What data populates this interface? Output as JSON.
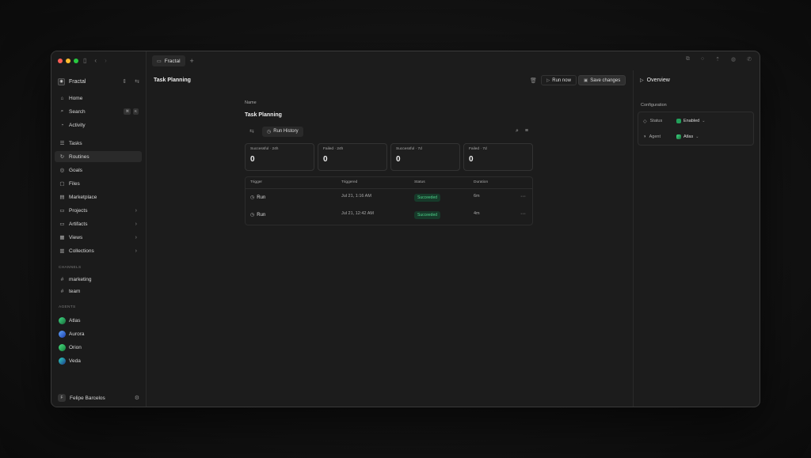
{
  "window": {
    "tab": {
      "label": "Fractal"
    },
    "tab_add": "+"
  },
  "sidebar": {
    "workspace": "Fractal",
    "nav": [
      {
        "label": "Home",
        "icon": "home-icon"
      },
      {
        "label": "Search",
        "icon": "search-icon"
      },
      {
        "label": "Activity",
        "icon": "activity-icon"
      },
      {
        "label": "Tasks",
        "icon": "tasks-icon"
      },
      {
        "label": "Routines",
        "icon": "routines-icon"
      },
      {
        "label": "Goals",
        "icon": "goals-icon"
      },
      {
        "label": "Files",
        "icon": "files-icon"
      },
      {
        "label": "Marketplace",
        "icon": "marketplace-icon"
      },
      {
        "label": "Projects",
        "icon": "folder-icon"
      },
      {
        "label": "Artifacts",
        "icon": "folder-icon"
      },
      {
        "label": "Views",
        "icon": "views-icon"
      },
      {
        "label": "Collections",
        "icon": "collections-icon"
      }
    ],
    "search_kbd": [
      "⌘",
      "K"
    ],
    "channels_label": "CHANNELS",
    "channels": [
      "marketing",
      "team"
    ],
    "agents_label": "AGENTS",
    "agents": [
      {
        "name": "Atlas",
        "color": "#2f9e44"
      },
      {
        "name": "Aurora",
        "color": "#3b82f6"
      },
      {
        "name": "Orion",
        "color": "#22a05a"
      },
      {
        "name": "Veda",
        "color": "#14b8a6"
      }
    ],
    "user": {
      "initial": "F",
      "name": "Felipe Barcelos"
    }
  },
  "main": {
    "title": "Task Planning",
    "run_now": "Run now",
    "save_changes": "Save changes",
    "name_label": "Name",
    "name_value": "Task Planning",
    "run_history": "Run History",
    "stats": [
      {
        "label": "Successful · 24h",
        "value": "0"
      },
      {
        "label": "Failed · 24h",
        "value": "0"
      },
      {
        "label": "Successful · 7d",
        "value": "0"
      },
      {
        "label": "Failed · 7d",
        "value": "0"
      }
    ],
    "table": {
      "headers": [
        "Trigger",
        "Triggered",
        "Status",
        "Duration"
      ],
      "rows": [
        {
          "trigger": "Run",
          "triggered": "Jul 21, 1:16 AM",
          "status": "Succeeded",
          "duration": "6m"
        },
        {
          "trigger": "Run",
          "triggered": "Jul 21, 12:42 AM",
          "status": "Succeeded",
          "duration": "4m"
        }
      ]
    }
  },
  "panel": {
    "title": "Overview",
    "config_label": "Configuration",
    "status_key": "Status",
    "status_value": "Enabled",
    "agent_key": "Agent",
    "agent_value": "Atlas",
    "status_color": "#22a05a",
    "agent_color": "#2f9e44"
  }
}
